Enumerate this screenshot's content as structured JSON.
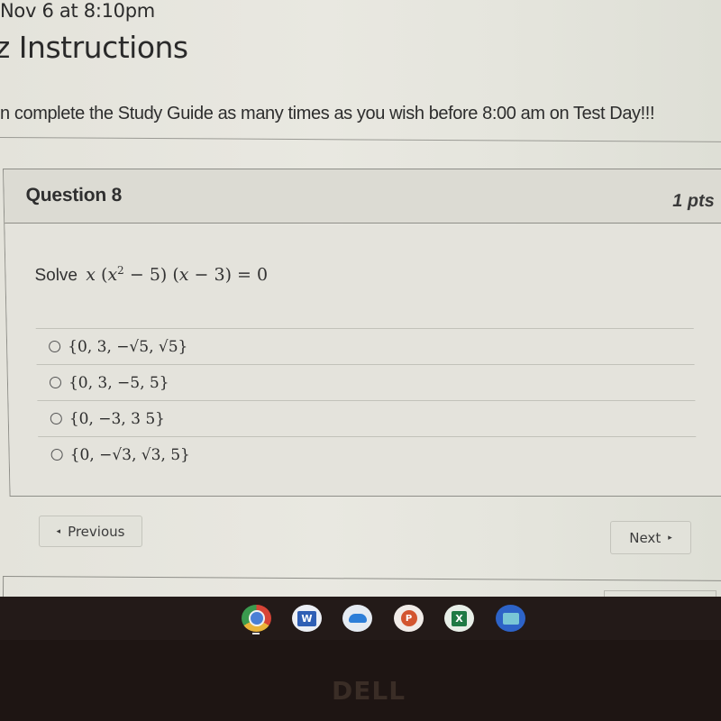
{
  "header": {
    "due_text": "Nov 6 at 8:10pm",
    "title": "z Instructions",
    "instructions": "n complete the Study Guide as many times as you wish before 8:00 am on Test Day!!!"
  },
  "question": {
    "title": "Question 8",
    "points": "1 pts",
    "prompt_label": "Solve",
    "equation": {
      "var": "x",
      "part1_open": "(",
      "part1_var": "x",
      "part1_exp": "2",
      "part1_rest": " − 5)",
      "part2": "(",
      "part2_var": "x",
      "part2_rest": " − 3) = 0"
    },
    "answers": [
      {
        "text": "{0, 3, −√5, √5}",
        "selected": false
      },
      {
        "text": "{0, 3, −5, 5}",
        "selected": false
      },
      {
        "text": "{0, −3, 3 5}",
        "selected": false
      },
      {
        "text": "{0, −√3, √3, 5}",
        "selected": false
      }
    ]
  },
  "nav": {
    "previous_label": "Previous",
    "previous_icon": "◂",
    "next_label": "Next",
    "next_icon": "▸"
  },
  "taskbar": {
    "apps": [
      {
        "name": "Chrome",
        "icon": "chrome-icon",
        "active": true
      },
      {
        "name": "Word",
        "icon": "word-icon",
        "glyph": "W"
      },
      {
        "name": "OneDrive",
        "icon": "onedrive-icon"
      },
      {
        "name": "PowerPoint",
        "icon": "powerpoint-icon",
        "glyph": "P"
      },
      {
        "name": "Excel",
        "icon": "excel-icon",
        "glyph": "X"
      },
      {
        "name": "Files",
        "icon": "files-icon"
      }
    ]
  },
  "device": {
    "logo": "DELL"
  }
}
